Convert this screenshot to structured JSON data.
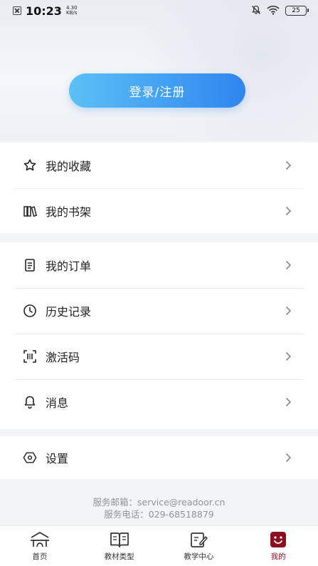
{
  "status_bar": {
    "time": "10:23",
    "net_speed_value": "4.30",
    "net_speed_unit": "KB/s",
    "battery": "25"
  },
  "header": {
    "login_label": "登录/注册"
  },
  "menu": {
    "group1": [
      {
        "label": "我的收藏",
        "icon": "star-icon"
      },
      {
        "label": "我的书架",
        "icon": "bookshelf-icon"
      }
    ],
    "group2": [
      {
        "label": "我的订单",
        "icon": "order-list-icon"
      },
      {
        "label": "历史记录",
        "icon": "clock-icon"
      },
      {
        "label": "激活码",
        "icon": "scan-code-icon"
      },
      {
        "label": "消息",
        "icon": "bell-icon"
      }
    ],
    "group3": [
      {
        "label": "设置",
        "icon": "settings-icon"
      }
    ]
  },
  "contact": {
    "email_line": "服务邮箱：service@readoor.cn",
    "phone_line": "服务电话：029-68518879"
  },
  "tabs": [
    {
      "label": "首页",
      "icon": "home-icon"
    },
    {
      "label": "教材类型",
      "icon": "book-icon"
    },
    {
      "label": "教学中心",
      "icon": "edit-notes-icon"
    },
    {
      "label": "我的",
      "icon": "profile-icon",
      "active": true
    }
  ],
  "colors": {
    "accent_gradient_start": "#5cc0f5",
    "accent_gradient_end": "#2e86ef",
    "active_tab": "#8a1020"
  }
}
